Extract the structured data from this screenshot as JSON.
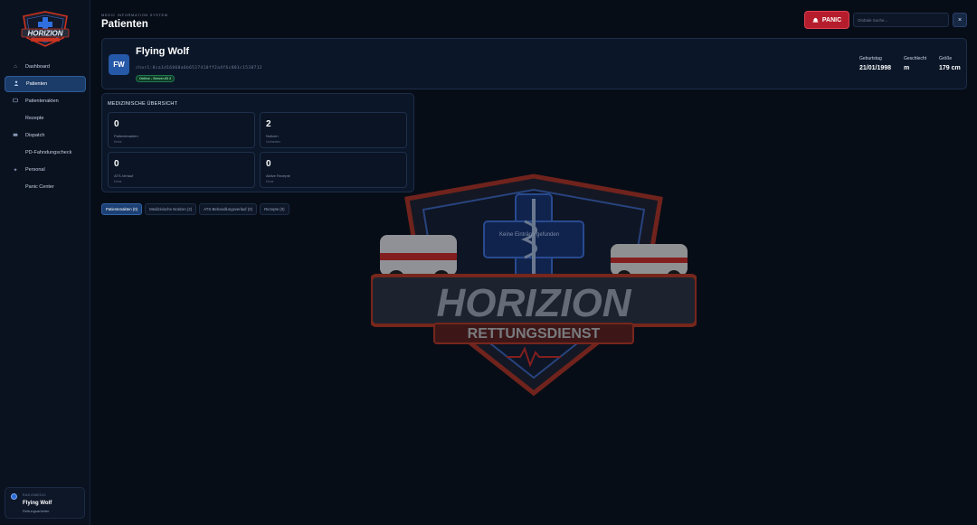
{
  "sidebar": {
    "brand": {
      "name": "HORIZION",
      "sub": "RETTUNGSDIENST"
    },
    "items": [
      {
        "label": "Dashboard",
        "icon": "home-icon",
        "active": false
      },
      {
        "label": "Patienten",
        "icon": "person-icon",
        "active": true
      },
      {
        "label": "Patientenakten",
        "icon": "file-icon",
        "active": false
      },
      {
        "label": "Rezepte",
        "icon": "",
        "active": false
      },
      {
        "label": "Dispatch",
        "icon": "ambulance-icon",
        "active": false
      },
      {
        "label": "PD-Fahndungscheck",
        "icon": "",
        "active": false
      },
      {
        "label": "Personal",
        "icon": "star-icon",
        "active": false
      },
      {
        "label": "Panic Center",
        "icon": "",
        "active": false
      }
    ],
    "user": {
      "role": "RADIOMEDIC",
      "name": "Flying Wolf",
      "title": "Rettungsarbeiter"
    }
  },
  "header": {
    "system_label": "MEDIC INFORMATION SYSTEM",
    "title": "Patienten",
    "panic_label": "PANIC",
    "search_placeholder": "Globale Suche...",
    "close_label": "×"
  },
  "patient": {
    "initials": "FW",
    "name": "Flying Wolf",
    "id": "char1:8ca1d16860a6b6527410ff2a4f6c001c1538712",
    "status": "Online - Server-ID 2",
    "stats": [
      {
        "label": "Geburtstag",
        "value": "21/01/1998"
      },
      {
        "label": "Geschlecht",
        "value": "m"
      },
      {
        "label": "Größe",
        "value": "179 cm"
      }
    ]
  },
  "overview": {
    "title": "MEDIZINISCHE ÜBERSICHT",
    "tiles": [
      {
        "value": "0",
        "label": "Patientenakten",
        "sub": "Keine"
      },
      {
        "value": "2",
        "label": "Notizen",
        "sub": "Vorhanden"
      },
      {
        "value": "0",
        "label": "ATS-Verlauf",
        "sub": "Keine"
      },
      {
        "value": "0",
        "label": "Aktive Rezepte",
        "sub": "Keine"
      }
    ]
  },
  "tabs": [
    {
      "label": "Patientenakten (0)",
      "active": true
    },
    {
      "label": "Medizinische Notizen (2)",
      "active": false
    },
    {
      "label": "ATS-Behandlungsverlauf (0)",
      "active": false
    },
    {
      "label": "Rezepte (0)",
      "active": false
    }
  ],
  "empty_state": "Keine Einträge gefunden",
  "colors": {
    "accent": "#2658a8",
    "panic": "#b51d2c",
    "background": "#070d17",
    "status_online": "#7fe0a6"
  }
}
